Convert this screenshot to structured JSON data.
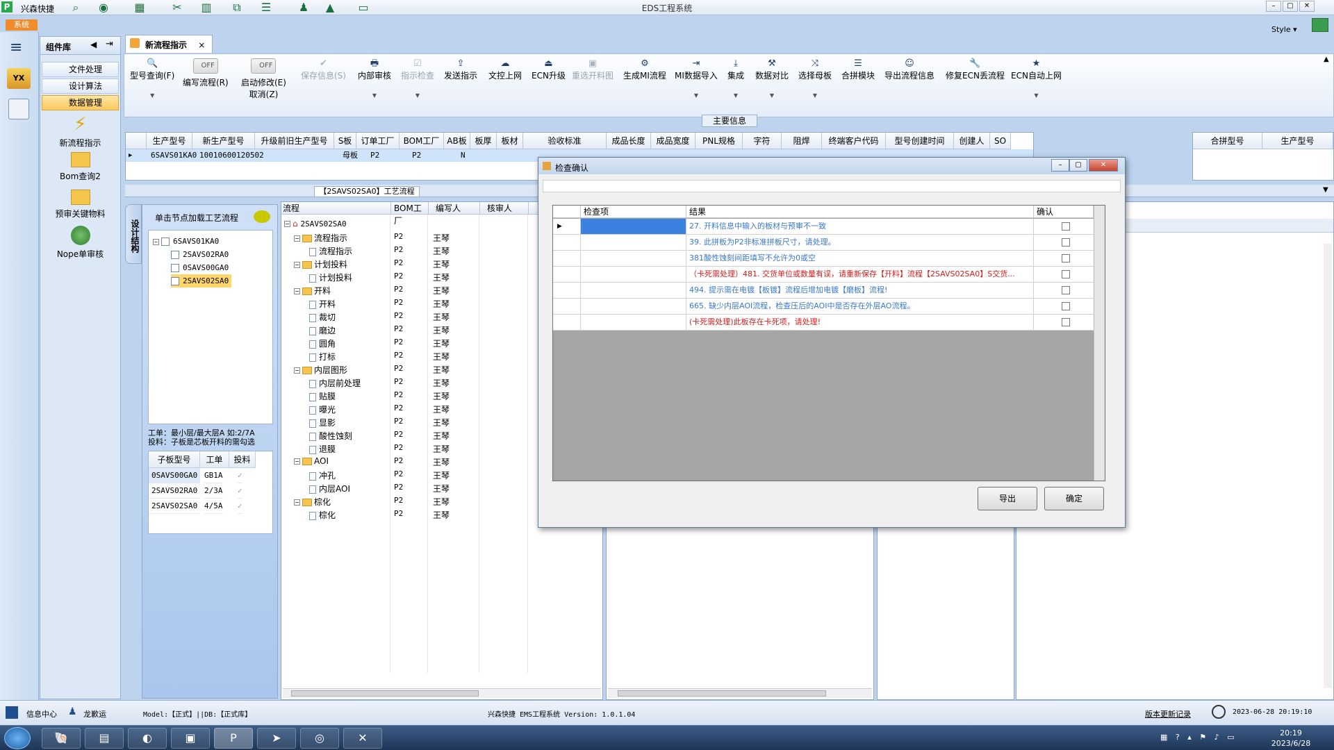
{
  "titlebar": {
    "app_name": "兴森快捷",
    "window_title": "EDS工程系统",
    "sys_tab": "系统",
    "style_label": "Style ▾",
    "window_buttons": [
      "–",
      "▢",
      "✕"
    ]
  },
  "component_panel": {
    "title": "组件库",
    "items": [
      "文件处理",
      "设计算法",
      "数据管理"
    ],
    "big_items": [
      "新流程指示",
      "Bom查询2",
      "预审关键物料",
      "Nope单审核"
    ]
  },
  "doc_tab": {
    "label": "新流程指示",
    "close": "×"
  },
  "toolbar": {
    "buttons": [
      {
        "label": "型号查询(F)",
        "icon": "🔍",
        "disabled": false
      },
      {
        "label": "编写流程(R)",
        "toggle": "OFF",
        "disabled": false
      },
      {
        "label": "启动修改(E)",
        "sub": "取消(Z)",
        "toggle": "OFF",
        "disabled": false
      },
      {
        "label": "保存信息(S)",
        "icon": "✔",
        "disabled": true
      },
      {
        "label": "内部审核",
        "icon": "🖶",
        "disabled": false
      },
      {
        "label": "指示检查",
        "icon": "☑",
        "disabled": true
      },
      {
        "label": "发送指示",
        "icon": "⇪",
        "disabled": false
      },
      {
        "label": "文控上网",
        "icon": "☁",
        "disabled": false
      },
      {
        "label": "ECN升级",
        "icon": "⏏",
        "disabled": false
      },
      {
        "label": "重选开料图",
        "icon": "▣",
        "disabled": true
      },
      {
        "label": "生成MI流程",
        "icon": "⚙",
        "disabled": false
      },
      {
        "label": "MI数据导入",
        "icon": "⇥",
        "disabled": false
      },
      {
        "label": "集成",
        "icon": "⤓",
        "disabled": false
      },
      {
        "label": "数据对比",
        "icon": "⚒",
        "disabled": false
      },
      {
        "label": "选择母板",
        "icon": "⤨",
        "disabled": false
      },
      {
        "label": "合拼模块",
        "icon": "☰",
        "disabled": false
      },
      {
        "label": "导出流程信息",
        "icon": "☺",
        "disabled": false
      },
      {
        "label": "修复ECN丢流程",
        "icon": "🔧",
        "disabled": false
      },
      {
        "label": "ECN自动上网",
        "icon": "★",
        "disabled": false
      }
    ]
  },
  "main_info": {
    "label": "主要信息",
    "columns": [
      "生产型号",
      "新生产型号",
      "升级前旧生产型号",
      "S板",
      "订单工厂",
      "BOM工厂",
      "AB板",
      "板厚",
      "板材",
      "验收标准",
      "成品长度",
      "成品宽度",
      "PNL规格",
      "字符",
      "阻焊",
      "终端客户代码",
      "型号创建时间",
      "创建人",
      "SO"
    ],
    "row": [
      "6SAVS01KA0",
      "10010600120502",
      "",
      "母板",
      "P2",
      "P2",
      "N",
      "",
      "",
      "",
      "",
      "",
      "",
      "",
      "",
      "",
      "",
      "",
      ""
    ],
    "side_columns": [
      "合拼型号",
      "生产型号"
    ]
  },
  "flow_tab": "【2SAVS02SA0】工艺流程",
  "vertical_tab": "设计结构",
  "structure": {
    "hint": "单击节点加载工艺流程",
    "tree": [
      {
        "label": "6SAVS01KA0",
        "level": 0,
        "selected": false
      },
      {
        "label": "2SAVS02RA0",
        "level": 1,
        "selected": false
      },
      {
        "label": "0SAVS00GA0",
        "level": 1,
        "selected": false
      },
      {
        "label": "2SAVS02SA0",
        "level": 1,
        "selected": true
      }
    ],
    "note_line1": "工单：最小层/最大层A 如:2/7A",
    "note_line2": "投料：子板是芯板开料的需勾选",
    "sub_columns": [
      "子板型号",
      "工单",
      "投料"
    ],
    "sub_rows": [
      {
        "model": "0SAVS00GA0",
        "order": "GB1A",
        "feed": "✓"
      },
      {
        "model": "2SAVS02RA0",
        "order": "2/3A",
        "feed": "✓"
      },
      {
        "model": "2SAVS02SA0",
        "order": "4/5A",
        "feed": "✓"
      }
    ]
  },
  "process": {
    "columns": [
      "流程",
      "BOM工厂",
      "编写人",
      "核审人"
    ],
    "root": "2SAVS02SA0",
    "rows": [
      {
        "name": "流程指示",
        "level": 1,
        "folder": true,
        "factory": "P2",
        "writer": "王琴"
      },
      {
        "name": "流程指示",
        "level": 2,
        "folder": false,
        "factory": "P2",
        "writer": "王琴"
      },
      {
        "name": "计划投料",
        "level": 1,
        "folder": true,
        "factory": "P2",
        "writer": "王琴"
      },
      {
        "name": "计划投料",
        "level": 2,
        "folder": false,
        "factory": "P2",
        "writer": "王琴"
      },
      {
        "name": "开料",
        "level": 1,
        "folder": true,
        "factory": "P2",
        "writer": "王琴"
      },
      {
        "name": "开料",
        "level": 2,
        "folder": false,
        "factory": "P2",
        "writer": "王琴"
      },
      {
        "name": "裁切",
        "level": 2,
        "folder": false,
        "factory": "P2",
        "writer": "王琴"
      },
      {
        "name": "磨边",
        "level": 2,
        "folder": false,
        "factory": "P2",
        "writer": "王琴"
      },
      {
        "name": "圆角",
        "level": 2,
        "folder": false,
        "factory": "P2",
        "writer": "王琴"
      },
      {
        "name": "打标",
        "level": 2,
        "folder": false,
        "factory": "P2",
        "writer": "王琴"
      },
      {
        "name": "内层图形",
        "level": 1,
        "folder": true,
        "factory": "P2",
        "writer": "王琴"
      },
      {
        "name": "内层前处理",
        "level": 2,
        "folder": false,
        "factory": "P2",
        "writer": "王琴"
      },
      {
        "name": "贴膜",
        "level": 2,
        "folder": false,
        "factory": "P2",
        "writer": "王琴"
      },
      {
        "name": "曝光",
        "level": 2,
        "folder": false,
        "factory": "P2",
        "writer": "王琴"
      },
      {
        "name": "显影",
        "level": 2,
        "folder": false,
        "factory": "P2",
        "writer": "王琴"
      },
      {
        "name": "酸性蚀刻",
        "level": 2,
        "folder": false,
        "factory": "P2",
        "writer": "王琴"
      },
      {
        "name": "退膜",
        "level": 2,
        "folder": false,
        "factory": "P2",
        "writer": "王琴"
      },
      {
        "name": "AOI",
        "level": 1,
        "folder": true,
        "factory": "P2",
        "writer": "王琴"
      },
      {
        "name": "冲孔",
        "level": 2,
        "folder": false,
        "factory": "P2",
        "writer": "王琴"
      },
      {
        "name": "内层AOI",
        "level": 2,
        "folder": false,
        "factory": "P2",
        "writer": "王琴"
      },
      {
        "name": "棕化",
        "level": 1,
        "folder": true,
        "factory": "P2",
        "writer": "王琴"
      },
      {
        "name": "棕化",
        "level": 2,
        "folder": false,
        "factory": "P2",
        "writer": "王琴"
      }
    ]
  },
  "dialog": {
    "title": "检查确认",
    "columns": [
      "检查项",
      "结果",
      "确认"
    ],
    "rows": [
      {
        "result": "27. 开料信息中输入的板材与预审不一致",
        "tone": "blue"
      },
      {
        "result": "39. 此拼板为P2非标准拼板尺寸，请处理。",
        "tone": "blue"
      },
      {
        "result": "381酸性蚀刻间距填写不允许为0或空",
        "tone": "blue"
      },
      {
        "result": "（卡死需处理）481. 交货单位或数量有误，请重新保存【开料】流程【2SAVS02SA0】S交货...",
        "tone": "red"
      },
      {
        "result": "494. 提示需在电镀【板镀】流程后增加电镀【磨板】流程!",
        "tone": "blue"
      },
      {
        "result": "665. 缺少内层AOI流程，检查压后的AOI中是否存在外层AO流程。",
        "tone": "blue"
      },
      {
        "result": "(卡死需处理)此板存在卡死项，请处理!",
        "tone": "red"
      }
    ],
    "export_button": "导出",
    "ok_button": "确定"
  },
  "statusbar": {
    "info_center": "信息中心",
    "user": "龙歉运",
    "model": "Model:【正式】||DB:【正式库】",
    "version": "兴森快捷 EMS工程系统 Version: 1.0.1.04",
    "update_link": "版本更新记录",
    "datetime": "2023-06-28 20:19:10"
  },
  "taskbar": {
    "time": "20:19",
    "date": "2023/6/28"
  },
  "colors": {
    "blue_text": "#3a78c9",
    "red_text": "#d11d1d",
    "selection": "#ffc95e",
    "row_highlight": "#cfe3fb"
  }
}
